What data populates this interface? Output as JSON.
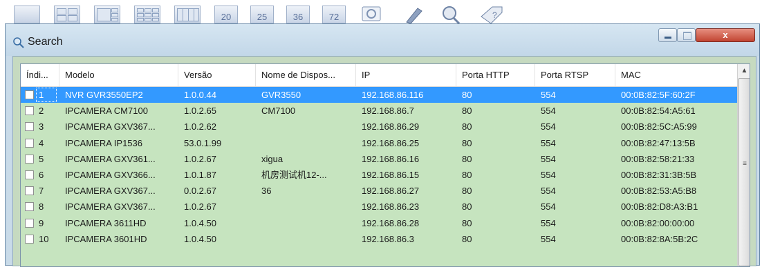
{
  "toolbar": {
    "layouts": [
      "layout-1x1",
      "layout-2x2",
      "layout-1plus3",
      "layout-3x3",
      "layout-4x4"
    ],
    "numbers": [
      "20",
      "25",
      "36",
      "72"
    ],
    "tools": [
      "capture-icon",
      "pen-icon",
      "search-zoom-icon",
      "tag-question-icon"
    ]
  },
  "window": {
    "title": "Search",
    "close_label": "x"
  },
  "table": {
    "columns": [
      "Índi...",
      "Modelo",
      "Versão",
      "Nome de Dispos...",
      "IP",
      "Porta HTTP",
      "Porta RTSP",
      "MAC"
    ],
    "rows": [
      {
        "index": "1",
        "model": "NVR GVR3550EP2",
        "version": "1.0.0.44",
        "name": "GVR3550",
        "ip": "192.168.86.116",
        "http": "80",
        "rtsp": "554",
        "mac": "00:0B:82:5F:60:2F",
        "selected": true
      },
      {
        "index": "2",
        "model": "IPCAMERA CM7100",
        "version": "1.0.2.65",
        "name": "CM7100",
        "ip": "192.168.86.7",
        "http": "80",
        "rtsp": "554",
        "mac": "00:0B:82:54:A5:61",
        "selected": false
      },
      {
        "index": "3",
        "model": "IPCAMERA GXV367...",
        "version": "1.0.2.62",
        "name": "",
        "ip": "192.168.86.29",
        "http": "80",
        "rtsp": "554",
        "mac": "00:0B:82:5C:A5:99",
        "selected": false
      },
      {
        "index": "4",
        "model": "IPCAMERA IP1536",
        "version": "53.0.1.99",
        "name": "",
        "ip": "192.168.86.25",
        "http": "80",
        "rtsp": "554",
        "mac": "00:0B:82:47:13:5B",
        "selected": false
      },
      {
        "index": "5",
        "model": "IPCAMERA GXV361...",
        "version": "1.0.2.67",
        "name": "xigua",
        "ip": "192.168.86.16",
        "http": "80",
        "rtsp": "554",
        "mac": "00:0B:82:58:21:33",
        "selected": false
      },
      {
        "index": "6",
        "model": "IPCAMERA GXV366...",
        "version": "1.0.1.87",
        "name": "机房测试机12-...",
        "ip": "192.168.86.15",
        "http": "80",
        "rtsp": "554",
        "mac": "00:0B:82:31:3B:5B",
        "selected": false
      },
      {
        "index": "7",
        "model": "IPCAMERA GXV367...",
        "version": "0.0.2.67",
        "name": "36",
        "ip": "192.168.86.27",
        "http": "80",
        "rtsp": "554",
        "mac": "00:0B:82:53:A5:B8",
        "selected": false
      },
      {
        "index": "8",
        "model": "IPCAMERA GXV367...",
        "version": "1.0.2.67",
        "name": "",
        "ip": "192.168.86.23",
        "http": "80",
        "rtsp": "554",
        "mac": "00:0B:82:D8:A3:B1",
        "selected": false
      },
      {
        "index": "9",
        "model": "IPCAMERA 3611HD",
        "version": "1.0.4.50",
        "name": "",
        "ip": "192.168.86.28",
        "http": "80",
        "rtsp": "554",
        "mac": "00:0B:82:00:00:00",
        "selected": false
      },
      {
        "index": "10",
        "model": "IPCAMERA 3601HD",
        "version": "1.0.4.50",
        "name": "",
        "ip": "192.168.86.3",
        "http": "80",
        "rtsp": "554",
        "mac": "00:0B:82:8A:5B:2C",
        "selected": false
      }
    ]
  },
  "colors": {
    "selection": "#3399ff",
    "list_background": "#c6e4bf",
    "close_button": "#c24431"
  }
}
